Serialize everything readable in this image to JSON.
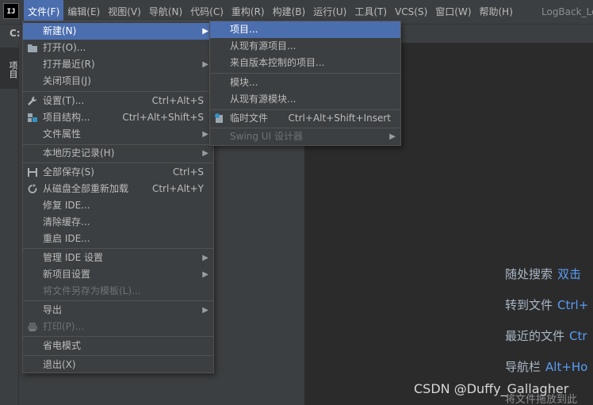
{
  "menubar": {
    "items": [
      "文件(F)",
      "编辑(E)",
      "视图(V)",
      "导航(N)",
      "代码(C)",
      "重构(R)",
      "构建(B)",
      "运行(U)",
      "工具(T)",
      "VCS(S)",
      "窗口(W)",
      "帮助(H)"
    ],
    "window_title": "LogBack_Le"
  },
  "toolbar": {
    "label": "C:"
  },
  "tool_stripe": {
    "project_tab": "项目"
  },
  "file_menu": {
    "items": [
      {
        "label": "新建(N)",
        "shortcut": "",
        "submenu": true,
        "icon": ""
      },
      {
        "label": "打开(O)...",
        "shortcut": "",
        "submenu": false,
        "icon": "folder-icon"
      },
      {
        "label": "打开最近(R)",
        "shortcut": "",
        "submenu": true,
        "icon": ""
      },
      {
        "label": "关闭项目(J)",
        "shortcut": "",
        "submenu": false,
        "icon": ""
      },
      {
        "label": "设置(T)...",
        "shortcut": "Ctrl+Alt+S",
        "submenu": false,
        "icon": "wrench-icon"
      },
      {
        "label": "项目结构...",
        "shortcut": "Ctrl+Alt+Shift+S",
        "submenu": false,
        "icon": "project-structure-icon"
      },
      {
        "label": "文件属性",
        "shortcut": "",
        "submenu": true,
        "icon": ""
      },
      {
        "label": "本地历史记录(H)",
        "shortcut": "",
        "submenu": true,
        "icon": ""
      },
      {
        "label": "全部保存(S)",
        "shortcut": "Ctrl+S",
        "submenu": false,
        "icon": "save-icon"
      },
      {
        "label": "从磁盘全部重新加载",
        "shortcut": "Ctrl+Alt+Y",
        "submenu": false,
        "icon": "reload-icon"
      },
      {
        "label": "修复 IDE...",
        "shortcut": "",
        "submenu": false,
        "icon": ""
      },
      {
        "label": "清除缓存...",
        "shortcut": "",
        "submenu": false,
        "icon": ""
      },
      {
        "label": "重启 IDE...",
        "shortcut": "",
        "submenu": false,
        "icon": ""
      },
      {
        "label": "管理 IDE 设置",
        "shortcut": "",
        "submenu": true,
        "icon": ""
      },
      {
        "label": "新项目设置",
        "shortcut": "",
        "submenu": true,
        "icon": ""
      },
      {
        "label": "将文件另存为模板(L)...",
        "shortcut": "",
        "submenu": false,
        "icon": ""
      },
      {
        "label": "导出",
        "shortcut": "",
        "submenu": true,
        "icon": ""
      },
      {
        "label": "打印(P)...",
        "shortcut": "",
        "submenu": false,
        "icon": "print-icon"
      },
      {
        "label": "省电模式",
        "shortcut": "",
        "submenu": false,
        "icon": ""
      },
      {
        "label": "退出(X)",
        "shortcut": "",
        "submenu": false,
        "icon": ""
      }
    ]
  },
  "new_submenu": {
    "items": [
      {
        "label": "项目...",
        "shortcut": "",
        "submenu": false
      },
      {
        "label": "从现有源项目...",
        "shortcut": "",
        "submenu": false
      },
      {
        "label": "来自版本控制的项目...",
        "shortcut": "",
        "submenu": false
      },
      {
        "label": "模块...",
        "shortcut": "",
        "submenu": false
      },
      {
        "label": "从现有源模块...",
        "shortcut": "",
        "submenu": false
      },
      {
        "label": "临时文件",
        "shortcut": "Ctrl+Alt+Shift+Insert",
        "submenu": false
      },
      {
        "label": "Swing UI 设计器",
        "shortcut": "",
        "submenu": true
      }
    ]
  },
  "editor_hints": [
    {
      "label": "随处搜索",
      "key": "双击"
    },
    {
      "label": "转到文件",
      "key": "Ctrl+"
    },
    {
      "label": "最近的文件",
      "key": "Ctr"
    },
    {
      "label": "导航栏",
      "key": "Alt+Ho"
    }
  ],
  "drop_hint": "将文件拖放到此",
  "watermark": "CSDN @Duffy_Gallagher",
  "colors": {
    "highlight": "#4b6eaf",
    "menu_bg": "#3c3f41",
    "editor_bg": "#2b2b2b",
    "link": "#589df6"
  }
}
